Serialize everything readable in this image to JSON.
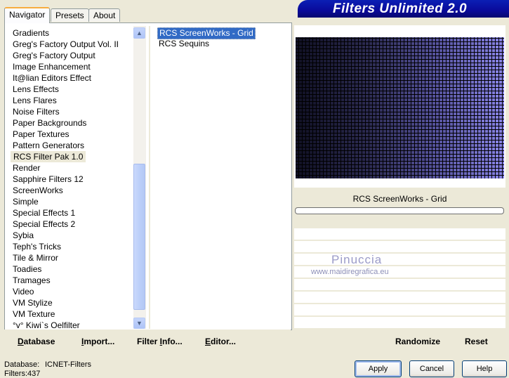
{
  "tabs": [
    "Navigator",
    "Presets",
    "About"
  ],
  "banner_title": "Filters Unlimited 2.0",
  "categories": [
    "Gradients",
    "Greg's Factory Output Vol. II",
    "Greg's Factory Output",
    "Image Enhancement",
    "It@lian Editors Effect",
    "Lens Effects",
    "Lens Flares",
    "Noise Filters",
    "Paper Backgrounds",
    "Paper Textures",
    "Pattern Generators",
    "RCS Filter Pak 1.0",
    "Render",
    "Sapphire Filters 12",
    "ScreenWorks",
    "Simple",
    "Special Effects 1",
    "Special Effects 2",
    "Sybia",
    "Teph's Tricks",
    "Tile & Mirror",
    "Toadies",
    "Tramages",
    "Video",
    "VM Stylize",
    "VM Texture",
    "°v° Kiwi`s Oelfilter"
  ],
  "selected_category": "RCS Filter Pak 1.0",
  "filters": [
    "RCS ScreenWorks - Grid",
    "RCS Sequins"
  ],
  "selected_filter": "RCS ScreenWorks - Grid",
  "preview": {
    "filter_name": "RCS ScreenWorks - Grid"
  },
  "watermark": {
    "name": "Pinuccia",
    "url": "www.maidiregrafica.eu"
  },
  "left_buttons": {
    "database": {
      "underline": "D",
      "rest": "atabase"
    },
    "import": {
      "underline": "I",
      "rest": "mport..."
    },
    "filter_info": {
      "pre": "Filter ",
      "underline": "I",
      "rest": "nfo..."
    },
    "editor": {
      "underline": "E",
      "rest": "ditor..."
    }
  },
  "right_buttons": {
    "randomize": "Randomize",
    "reset": "Reset"
  },
  "status": {
    "database_label": "Database:",
    "database_value": "ICNET-Filters",
    "filters_label": "Filters:",
    "filters_value": "437"
  },
  "dialog_buttons": {
    "apply": "Apply",
    "cancel": "Cancel",
    "help": "Help"
  },
  "colors": {
    "selection": "#316ac5",
    "banner": "#0a0a9a",
    "tab_highlight": "#f7ad3f"
  }
}
